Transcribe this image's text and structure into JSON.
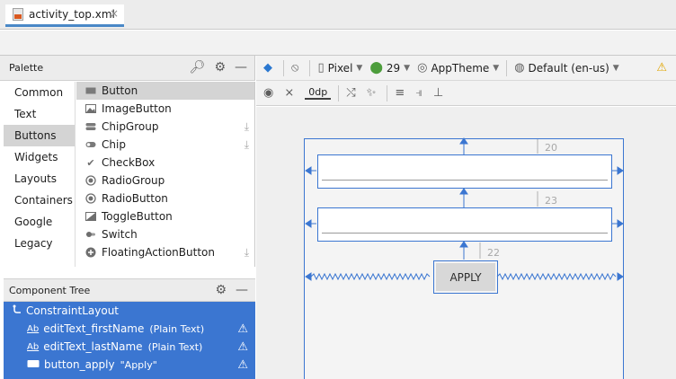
{
  "tab": {
    "file_name": "activity_top.xml",
    "close_glyph": "×"
  },
  "palette": {
    "title": "Palette",
    "icons": [
      "search-icon",
      "gear-icon",
      "minimize-icon"
    ],
    "categories": [
      "Common",
      "Text",
      "Buttons",
      "Widgets",
      "Layouts",
      "Containers",
      "Google",
      "Legacy"
    ],
    "selected_category": "Buttons",
    "widgets": [
      {
        "label": "Button",
        "icon": "button-icon",
        "download": false
      },
      {
        "label": "ImageButton",
        "icon": "image-icon",
        "download": false
      },
      {
        "label": "ChipGroup",
        "icon": "chip-group-icon",
        "download": true
      },
      {
        "label": "Chip",
        "icon": "chip-icon",
        "download": true
      },
      {
        "label": "CheckBox",
        "icon": "check-icon",
        "download": false
      },
      {
        "label": "RadioGroup",
        "icon": "radio-icon",
        "download": false
      },
      {
        "label": "RadioButton",
        "icon": "radio-icon",
        "download": false
      },
      {
        "label": "ToggleButton",
        "icon": "toggle-icon",
        "download": false
      },
      {
        "label": "Switch",
        "icon": "switch-icon",
        "download": false
      },
      {
        "label": "FloatingActionButton",
        "icon": "add-icon",
        "download": true
      }
    ],
    "selected_widget": "Button"
  },
  "component_tree": {
    "title": "Component Tree",
    "root": "ConstraintLayout",
    "rows": [
      {
        "name": "editText_firstName",
        "type": "(Plain Text)",
        "icon": "text-field-icon"
      },
      {
        "name": "editText_lastName",
        "type": "(Plain Text)",
        "icon": "text-field-icon"
      },
      {
        "name": "button_apply",
        "type": "\"Apply\"",
        "icon": "button-icon"
      }
    ]
  },
  "toolbar": {
    "device": "Pixel",
    "api": "29",
    "theme": "AppTheme",
    "locale": "Default (en-us)",
    "default_margin": "0dp"
  },
  "canvas": {
    "margins": [
      "20",
      "23",
      "22"
    ],
    "button_label": "APPLY",
    "accent": "#3b76d1"
  }
}
